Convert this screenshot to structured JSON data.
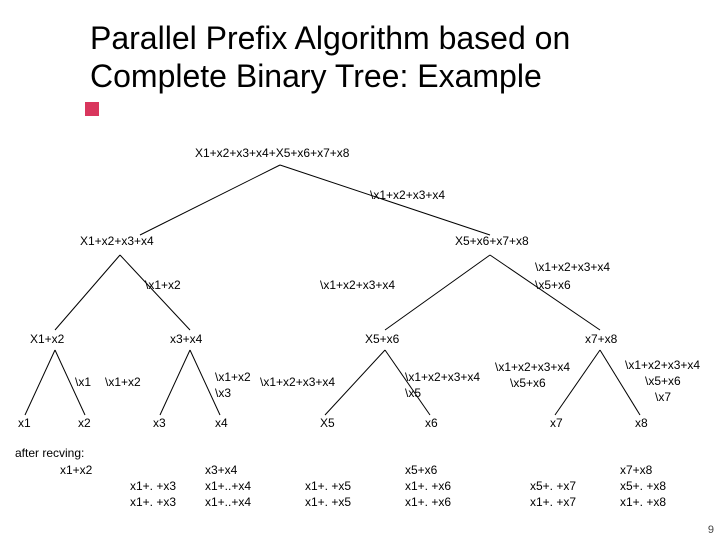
{
  "title": "Parallel Prefix Algorithm based on\nComplete Binary Tree: Example",
  "root": {
    "label": "X1+x2+x3+x4+X5+x6+x7+x8"
  },
  "rootBack": "\\x1+x2+x3+x4",
  "l2": {
    "left": {
      "label": "X1+x2+x3+x4"
    },
    "right": {
      "label": "X5+x6+x7+x8"
    },
    "backR": "\\x1+x2+x3+x4"
  },
  "l3": {
    "ll": "X1+x2",
    "lr": "x3+x4",
    "rl": "X5+x6",
    "rr": "x7+x8",
    "back_ll": "\\x1+x2",
    "back_lr": "\\x1+x2+x3+x4",
    "back_rl_1": "\\x5+x6",
    "back_rr_1": "\\x1+x2+x3+x4",
    "back_rr_2": "\\x5+x6"
  },
  "leaves": {
    "x1": "x1",
    "x2": "x2",
    "x3": "x3",
    "x4": "x4",
    "X5": "X5",
    "x6": "x6",
    "x7": "x7",
    "x8": "x8"
  },
  "leafBack": {
    "l1": "\\x1",
    "l2": "\\x1+x2",
    "l3_1": "\\x1+x2",
    "l3_2": "\\x3",
    "l4": "\\x1+x2+x3+x4",
    "l5_1": "\\x1+x2+x3+x4",
    "l5_2": "\\x5",
    "l6_1": "\\x1+x2+x3+x4",
    "l6_2": "\\x5+x6",
    "l7_1": "\\x1+x2+x3+x4",
    "l7_2": "\\x5+x6",
    "l7_3": "\\x7"
  },
  "after": {
    "title": "after recving:",
    "c1": "x1+x2",
    "c2": "x1+. +x3\nx1+. +x3",
    "c3": "x3+x4\nx1+..+x4\nx1+..+x4",
    "c4": "x1+. +x5\nx1+. +x5",
    "c5": "x5+x6\nx1+. +x6\nx1+. +x6",
    "c6": "x5+. +x7\nx1+. +x7",
    "c7": "x7+x8\nx5+. +x8\nx1+. +x8"
  },
  "page": "9"
}
